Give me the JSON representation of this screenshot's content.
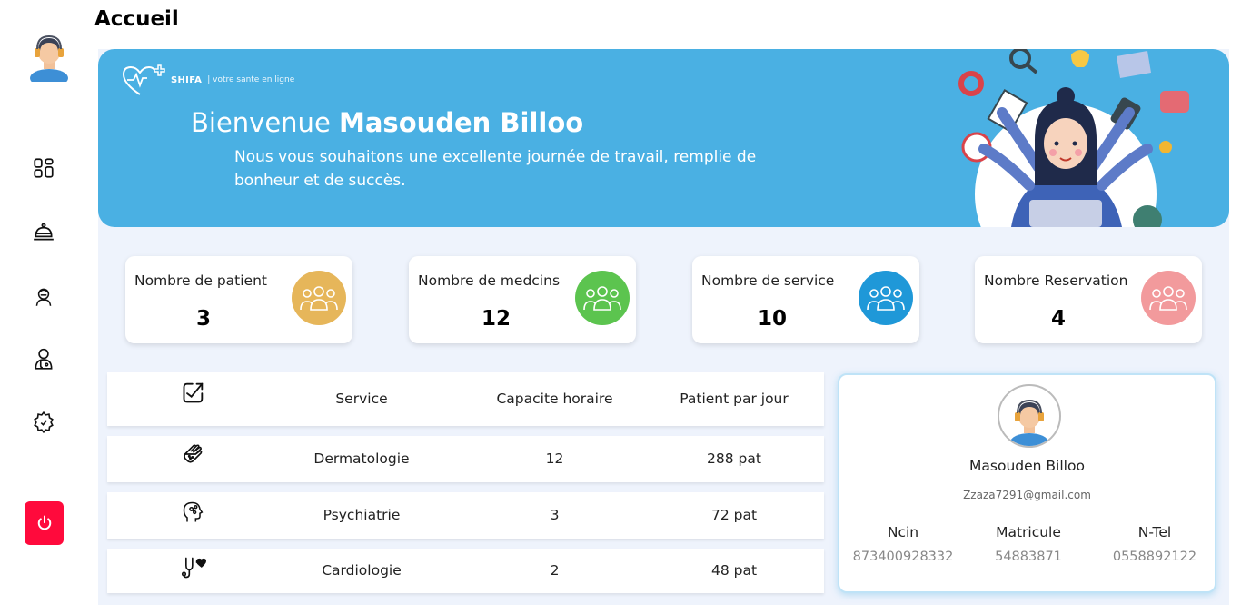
{
  "page": {
    "title": "Accueil"
  },
  "sidebar": {
    "avatar_icon": "user-headset-avatar",
    "items": [
      {
        "name": "dashboard",
        "icon": "dashboard-icon"
      },
      {
        "name": "services",
        "icon": "service-bell-icon"
      },
      {
        "name": "patients",
        "icon": "patient-icon"
      },
      {
        "name": "doctors",
        "icon": "doctor-icon"
      },
      {
        "name": "settings",
        "icon": "gear-icon"
      }
    ],
    "logout_icon": "power-icon",
    "logout_color": "#ff0a3c"
  },
  "banner": {
    "brand_name": "SHIFA",
    "brand_tagline": "| votre sante en ligne",
    "welcome_prefix": "Bienvenue ",
    "welcome_name": "Masouden Billoo",
    "subtitle": "Nous vous souhaitons une excellente journée de travail, remplie de bonheur et de succès.",
    "background": "#4ab0e3"
  },
  "stats": [
    {
      "label": "Nombre de patient",
      "value": "3",
      "color": "#e6b65a"
    },
    {
      "label": "Nombre de medcins",
      "value": "12",
      "color": "#5cc44f"
    },
    {
      "label": "Nombre de service",
      "value": "10",
      "color": "#1f98d8"
    },
    {
      "label": "Nombre Reservation",
      "value": "4",
      "color": "#f29a9c"
    }
  ],
  "services_table": {
    "header_icon": "trend-chart-icon",
    "headers": {
      "service": "Service",
      "capacity": "Capacite horaire",
      "patients": "Patient par jour"
    },
    "rows": [
      {
        "icon": "skin-hand-icon",
        "service": "Dermatologie",
        "capacity": "12",
        "patients": "288 pat"
      },
      {
        "icon": "brain-head-icon",
        "service": "Psychiatrie",
        "capacity": "3",
        "patients": "72 pat"
      },
      {
        "icon": "stethoscope-heart-icon",
        "service": "Cardiologie",
        "capacity": "2",
        "patients": "48 pat"
      }
    ]
  },
  "profile": {
    "name": "Masouden Billoo",
    "email": "Zzaza7291@gmail.com",
    "ncin_label": "Ncin",
    "ncin": "873400928332",
    "matricule_label": "Matricule",
    "matricule": "54883871",
    "tel_label": "N-Tel",
    "tel": "0558892122"
  }
}
